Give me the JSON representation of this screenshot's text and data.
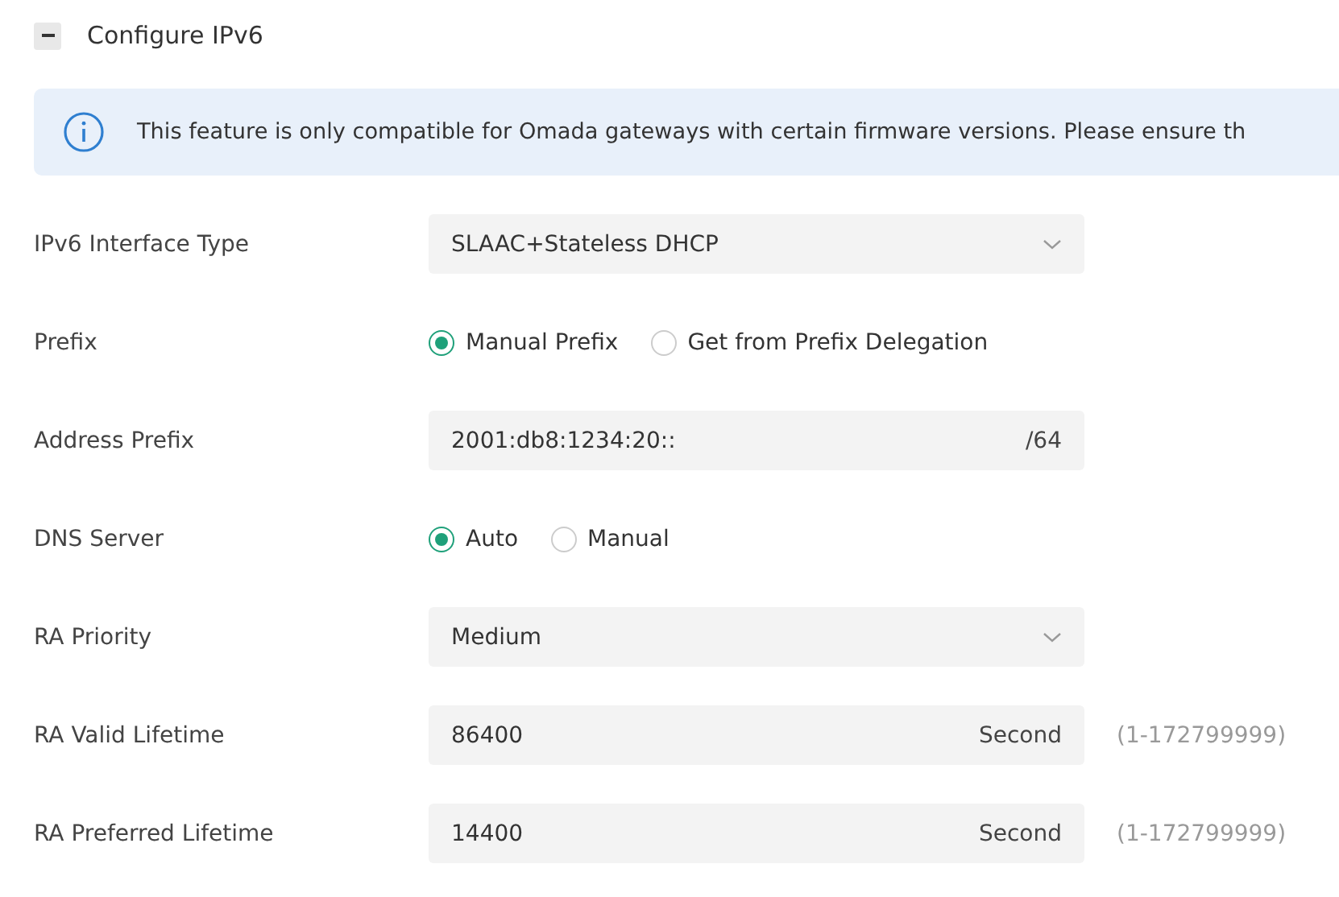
{
  "section": {
    "title": "Configure IPv6",
    "expanded": true
  },
  "notice": {
    "text": "This feature is only compatible for Omada gateways with certain firmware versions. Please ensure th"
  },
  "fields": [
    {
      "label": "IPv6 Interface Type",
      "kind": "select",
      "value": "SLAAC+Stateless DHCP"
    },
    {
      "label": "Prefix",
      "kind": "radio",
      "options": [
        {
          "label": "Manual Prefix",
          "selected": true
        },
        {
          "label": "Get from Prefix Delegation",
          "selected": false
        }
      ]
    },
    {
      "label": "Address Prefix",
      "kind": "input",
      "value": "2001:db8:1234:20::",
      "suffix": "/64"
    },
    {
      "label": "DNS Server",
      "kind": "radio",
      "options": [
        {
          "label": "Auto",
          "selected": true
        },
        {
          "label": "Manual",
          "selected": false
        }
      ]
    },
    {
      "label": "RA Priority",
      "kind": "select",
      "value": "Medium"
    },
    {
      "label": "RA Valid Lifetime",
      "kind": "input",
      "value": "86400",
      "suffix": "Second",
      "hint": "(1-172799999)"
    },
    {
      "label": "RA Preferred Lifetime",
      "kind": "input",
      "value": "14400",
      "suffix": "Second",
      "hint": "(1-172799999)"
    }
  ]
}
